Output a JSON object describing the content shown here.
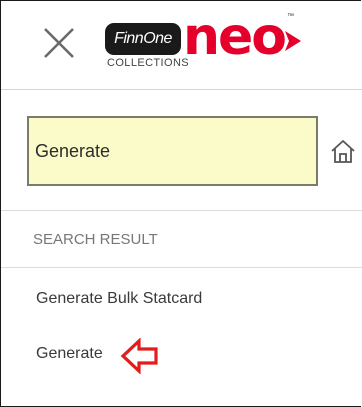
{
  "header": {
    "close_icon": "close-icon",
    "logo": {
      "brand": "FinnOne",
      "product": "neo",
      "trademark": "™",
      "module": "COLLECTIONS"
    },
    "colors": {
      "brand_red": "#e4002b",
      "brand_black": "#1a1a1a"
    }
  },
  "search": {
    "value": "Generate",
    "background": "#fafbc9"
  },
  "home_icon": "home-icon",
  "results": {
    "title": "SEARCH RESULT",
    "items": [
      {
        "label": "Generate Bulk Statcard"
      },
      {
        "label": "Generate"
      }
    ],
    "annotation_icon": "red-left-arrow-icon",
    "annotation_color": "#e11d1d"
  }
}
